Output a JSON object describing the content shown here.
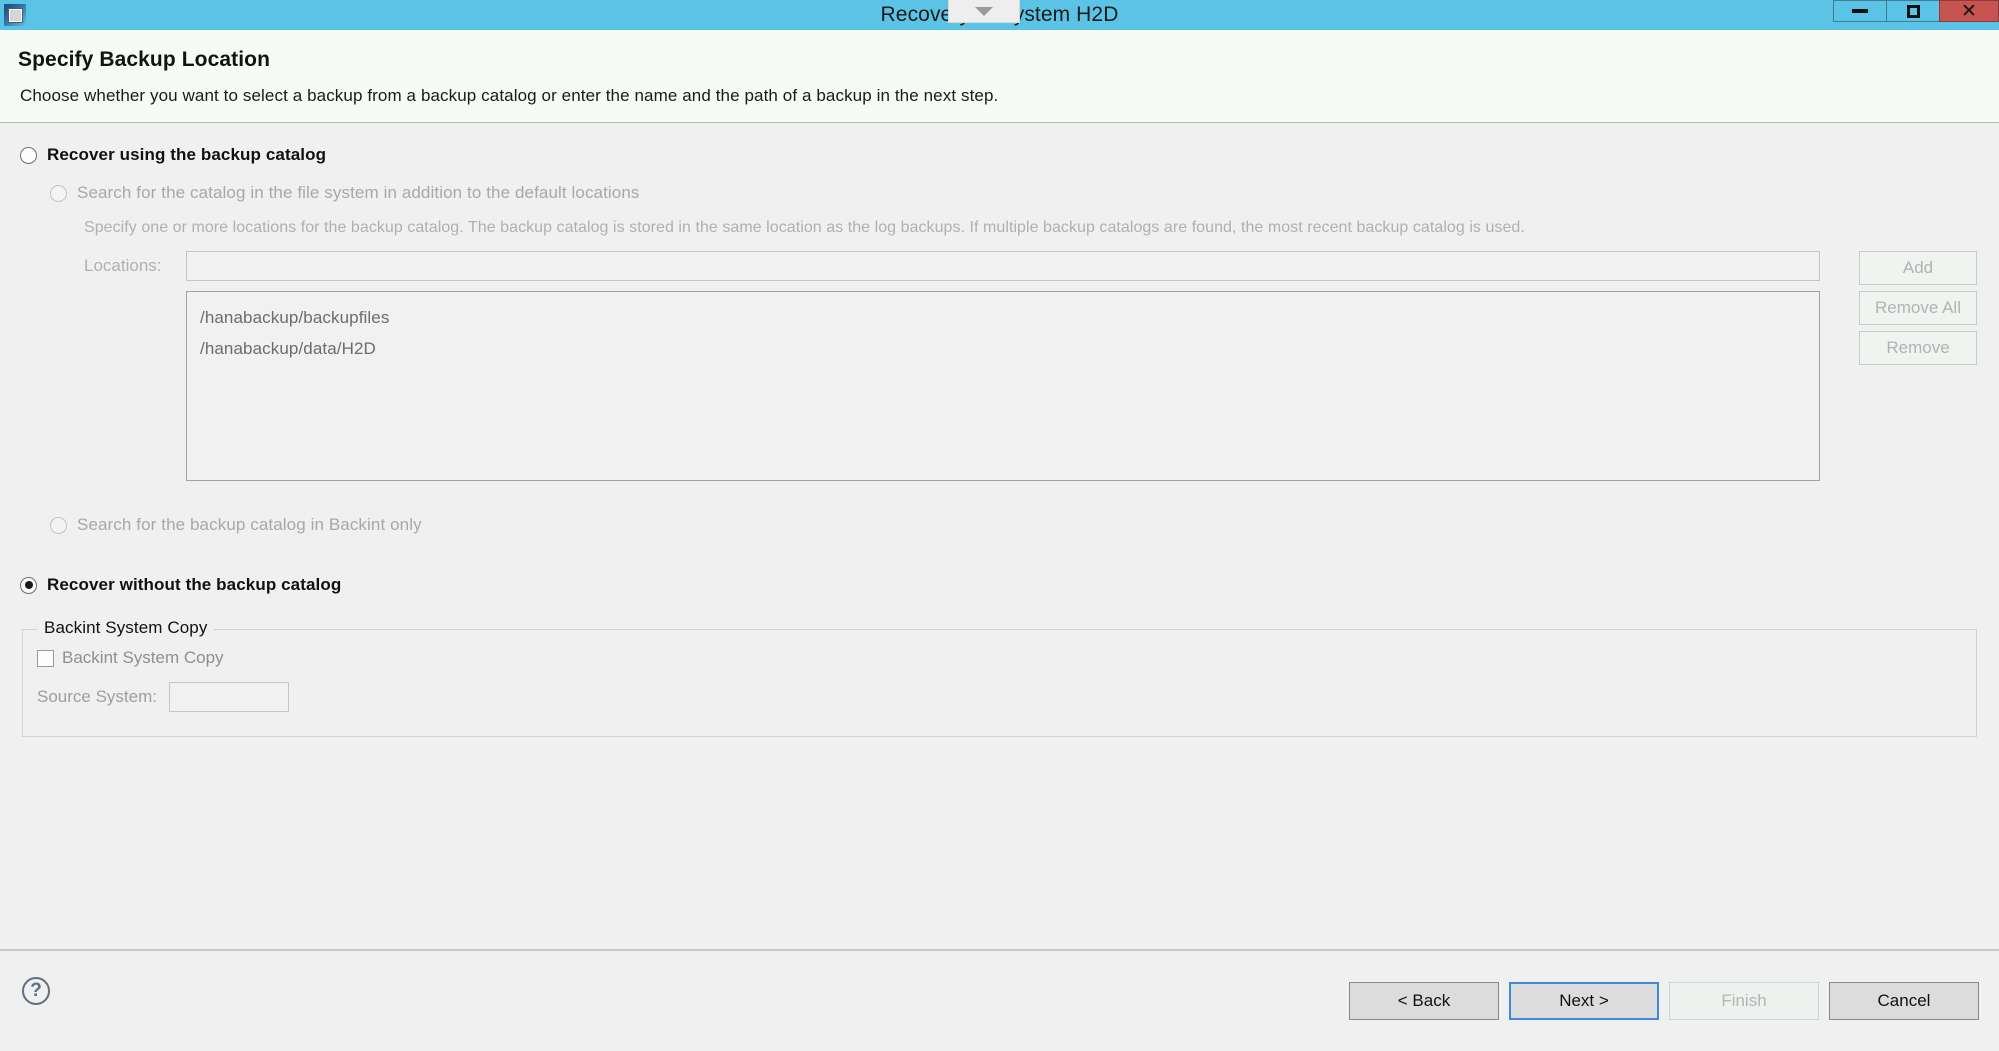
{
  "window": {
    "title": "Recovery of System H2D",
    "app_icon": "chip-icon",
    "controls": {
      "minimize": "minimize-icon",
      "maximize": "maximize-icon",
      "close": "close-icon"
    },
    "pulltab_icon": "chevron-down-icon"
  },
  "header": {
    "title": "Specify Backup Location",
    "description": "Choose whether you want to select a backup from a backup catalog or enter the name and the path of a backup in the next step."
  },
  "options": {
    "use_catalog": {
      "label": "Recover using the backup catalog",
      "checked": false
    },
    "search_filesystem": {
      "label": "Search for the catalog in the file system in addition to the default locations",
      "checked": false,
      "enabled": false
    },
    "search_backint_only": {
      "label": "Search for the backup catalog in Backint only",
      "checked": false,
      "enabled": false
    },
    "without_catalog": {
      "label": "Recover without the backup catalog",
      "checked": true
    }
  },
  "catalog_section": {
    "description": "Specify one or more locations for the backup catalog. The backup catalog is stored in the same location as the log backups. If multiple backup catalogs are found, the most recent backup catalog is used.",
    "locations_label": "Locations:",
    "locations_value": "",
    "locations_placeholder": "",
    "list_items": [
      "/hanabackup/backupfiles",
      "/hanabackup/data/H2D"
    ],
    "buttons": {
      "add": "Add",
      "remove_all": "Remove All",
      "remove": "Remove"
    }
  },
  "backint_group": {
    "legend": "Backint System Copy",
    "checkbox_label": "Backint System Copy",
    "checkbox_checked": false,
    "source_system_label": "Source System:",
    "source_system_value": ""
  },
  "footer": {
    "help_icon": "question-mark-icon",
    "buttons": {
      "back": "< Back",
      "next": "Next >",
      "finish": "Finish",
      "cancel": "Cancel"
    }
  },
  "colors": {
    "titlebar": "#5bc4e6",
    "close_button": "#c75450",
    "focus_border": "#3c8bd4",
    "header_band": "#f6fbf6",
    "body": "#f0f0f0"
  }
}
